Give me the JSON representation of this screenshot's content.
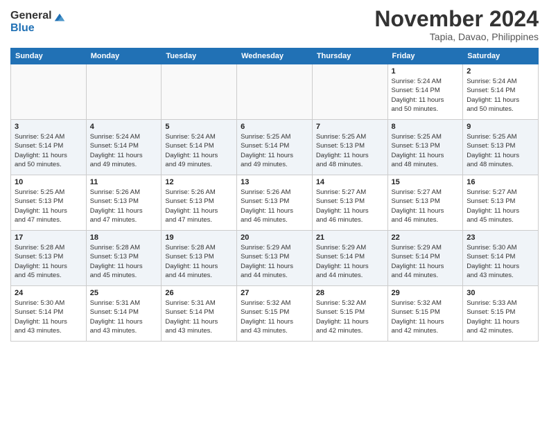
{
  "header": {
    "logo_general": "General",
    "logo_blue": "Blue",
    "month_title": "November 2024",
    "location": "Tapia, Davao, Philippines"
  },
  "weekdays": [
    "Sunday",
    "Monday",
    "Tuesday",
    "Wednesday",
    "Thursday",
    "Friday",
    "Saturday"
  ],
  "weeks": [
    [
      {
        "day": "",
        "info": ""
      },
      {
        "day": "",
        "info": ""
      },
      {
        "day": "",
        "info": ""
      },
      {
        "day": "",
        "info": ""
      },
      {
        "day": "",
        "info": ""
      },
      {
        "day": "1",
        "info": "Sunrise: 5:24 AM\nSunset: 5:14 PM\nDaylight: 11 hours\nand 50 minutes."
      },
      {
        "day": "2",
        "info": "Sunrise: 5:24 AM\nSunset: 5:14 PM\nDaylight: 11 hours\nand 50 minutes."
      }
    ],
    [
      {
        "day": "3",
        "info": "Sunrise: 5:24 AM\nSunset: 5:14 PM\nDaylight: 11 hours\nand 50 minutes."
      },
      {
        "day": "4",
        "info": "Sunrise: 5:24 AM\nSunset: 5:14 PM\nDaylight: 11 hours\nand 49 minutes."
      },
      {
        "day": "5",
        "info": "Sunrise: 5:24 AM\nSunset: 5:14 PM\nDaylight: 11 hours\nand 49 minutes."
      },
      {
        "day": "6",
        "info": "Sunrise: 5:25 AM\nSunset: 5:14 PM\nDaylight: 11 hours\nand 49 minutes."
      },
      {
        "day": "7",
        "info": "Sunrise: 5:25 AM\nSunset: 5:13 PM\nDaylight: 11 hours\nand 48 minutes."
      },
      {
        "day": "8",
        "info": "Sunrise: 5:25 AM\nSunset: 5:13 PM\nDaylight: 11 hours\nand 48 minutes."
      },
      {
        "day": "9",
        "info": "Sunrise: 5:25 AM\nSunset: 5:13 PM\nDaylight: 11 hours\nand 48 minutes."
      }
    ],
    [
      {
        "day": "10",
        "info": "Sunrise: 5:25 AM\nSunset: 5:13 PM\nDaylight: 11 hours\nand 47 minutes."
      },
      {
        "day": "11",
        "info": "Sunrise: 5:26 AM\nSunset: 5:13 PM\nDaylight: 11 hours\nand 47 minutes."
      },
      {
        "day": "12",
        "info": "Sunrise: 5:26 AM\nSunset: 5:13 PM\nDaylight: 11 hours\nand 47 minutes."
      },
      {
        "day": "13",
        "info": "Sunrise: 5:26 AM\nSunset: 5:13 PM\nDaylight: 11 hours\nand 46 minutes."
      },
      {
        "day": "14",
        "info": "Sunrise: 5:27 AM\nSunset: 5:13 PM\nDaylight: 11 hours\nand 46 minutes."
      },
      {
        "day": "15",
        "info": "Sunrise: 5:27 AM\nSunset: 5:13 PM\nDaylight: 11 hours\nand 46 minutes."
      },
      {
        "day": "16",
        "info": "Sunrise: 5:27 AM\nSunset: 5:13 PM\nDaylight: 11 hours\nand 45 minutes."
      }
    ],
    [
      {
        "day": "17",
        "info": "Sunrise: 5:28 AM\nSunset: 5:13 PM\nDaylight: 11 hours\nand 45 minutes."
      },
      {
        "day": "18",
        "info": "Sunrise: 5:28 AM\nSunset: 5:13 PM\nDaylight: 11 hours\nand 45 minutes."
      },
      {
        "day": "19",
        "info": "Sunrise: 5:28 AM\nSunset: 5:13 PM\nDaylight: 11 hours\nand 44 minutes."
      },
      {
        "day": "20",
        "info": "Sunrise: 5:29 AM\nSunset: 5:13 PM\nDaylight: 11 hours\nand 44 minutes."
      },
      {
        "day": "21",
        "info": "Sunrise: 5:29 AM\nSunset: 5:14 PM\nDaylight: 11 hours\nand 44 minutes."
      },
      {
        "day": "22",
        "info": "Sunrise: 5:29 AM\nSunset: 5:14 PM\nDaylight: 11 hours\nand 44 minutes."
      },
      {
        "day": "23",
        "info": "Sunrise: 5:30 AM\nSunset: 5:14 PM\nDaylight: 11 hours\nand 43 minutes."
      }
    ],
    [
      {
        "day": "24",
        "info": "Sunrise: 5:30 AM\nSunset: 5:14 PM\nDaylight: 11 hours\nand 43 minutes."
      },
      {
        "day": "25",
        "info": "Sunrise: 5:31 AM\nSunset: 5:14 PM\nDaylight: 11 hours\nand 43 minutes."
      },
      {
        "day": "26",
        "info": "Sunrise: 5:31 AM\nSunset: 5:14 PM\nDaylight: 11 hours\nand 43 minutes."
      },
      {
        "day": "27",
        "info": "Sunrise: 5:32 AM\nSunset: 5:15 PM\nDaylight: 11 hours\nand 43 minutes."
      },
      {
        "day": "28",
        "info": "Sunrise: 5:32 AM\nSunset: 5:15 PM\nDaylight: 11 hours\nand 42 minutes."
      },
      {
        "day": "29",
        "info": "Sunrise: 5:32 AM\nSunset: 5:15 PM\nDaylight: 11 hours\nand 42 minutes."
      },
      {
        "day": "30",
        "info": "Sunrise: 5:33 AM\nSunset: 5:15 PM\nDaylight: 11 hours\nand 42 minutes."
      }
    ]
  ]
}
